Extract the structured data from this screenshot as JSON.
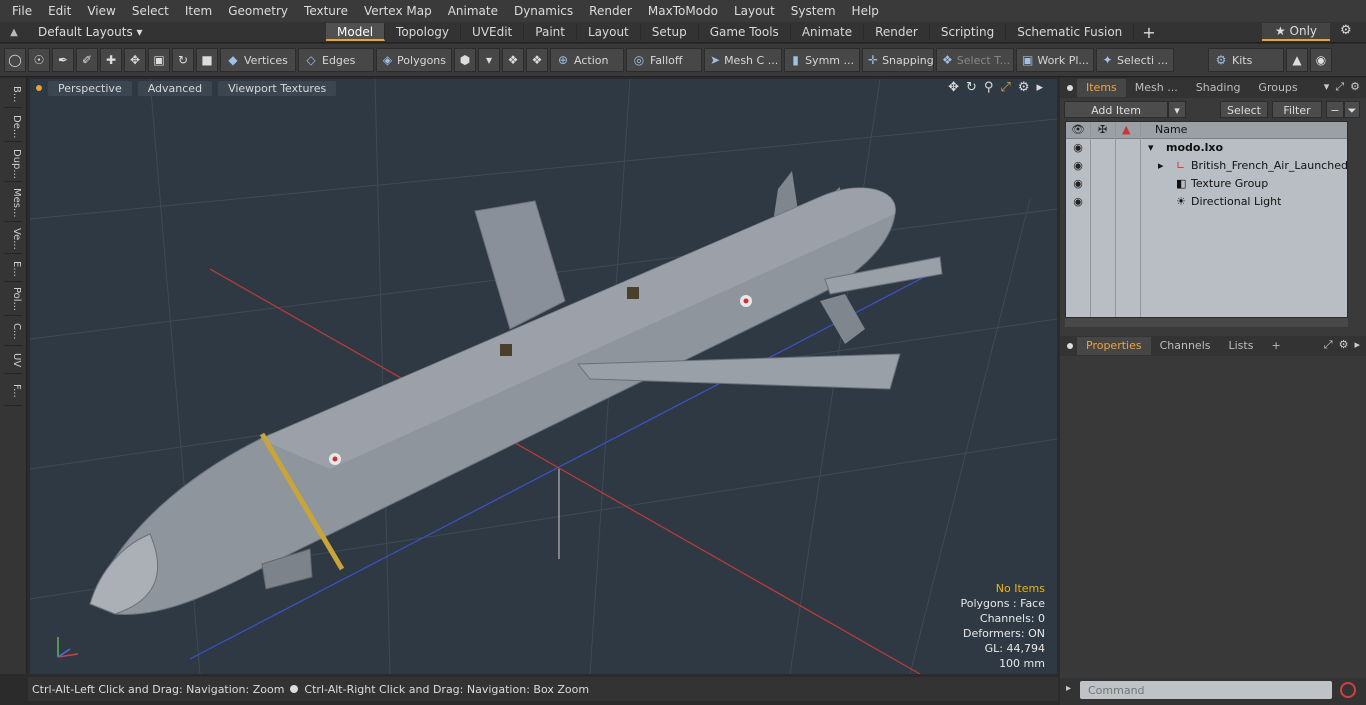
{
  "menu": [
    "File",
    "Edit",
    "View",
    "Select",
    "Item",
    "Geometry",
    "Texture",
    "Vertex Map",
    "Animate",
    "Dynamics",
    "Render",
    "MaxToModo",
    "Layout",
    "System",
    "Help"
  ],
  "layout": {
    "current": "Default Layouts ▾",
    "tabs": [
      "Model",
      "Topology",
      "UVEdit",
      "Paint",
      "Layout",
      "Setup",
      "Game Tools",
      "Animate",
      "Render",
      "Scripting",
      "Schematic Fusion"
    ],
    "active_tab": "Model",
    "only_label": "★ Only"
  },
  "toolbar": {
    "vertices": "Vertices",
    "edges": "Edges",
    "polygons": "Polygons",
    "action": "Action",
    "falloff": "Falloff",
    "mesh": "Mesh C ...",
    "symmetry": "Symm ...",
    "snapping": "Snapping",
    "select_t": "Select T...",
    "workplane": "Work Pl...",
    "selection": "Selecti ...",
    "kits": "Kits"
  },
  "leftstrip": [
    "B...",
    "De...",
    "Dup...",
    "Mes...",
    "Ve...",
    "E...",
    "Pol...",
    "C...",
    "UV",
    "F..."
  ],
  "viewport": {
    "perspective": "Perspective",
    "advanced": "Advanced",
    "textures": "Viewport Textures",
    "info": {
      "no_items": "No Items",
      "polygons": "Polygons : Face",
      "channels": "Channels: 0",
      "deformers": "Deformers: ON",
      "gl": "GL: 44,794",
      "scale": "100 mm"
    }
  },
  "status": {
    "left": "Ctrl-Alt-Left Click and Drag: Navigation: Zoom",
    "right": "Ctrl-Alt-Right Click and Drag: Navigation: Box Zoom"
  },
  "items_panel": {
    "tabs": [
      "Items",
      "Mesh ...",
      "Shading",
      "Groups"
    ],
    "add_item": "Add Item",
    "select": "Select",
    "filter": "Filter",
    "column_name": "Name",
    "rows": [
      {
        "label": "modo.lxo"
      },
      {
        "label": "British_French_Air_Launched ..."
      },
      {
        "label": "Texture Group"
      },
      {
        "label": "Directional Light"
      }
    ]
  },
  "properties_panel": {
    "tabs": [
      "Properties",
      "Channels",
      "Lists"
    ]
  },
  "command": {
    "placeholder": "Command"
  },
  "colors": {
    "accent": "#e7a33a",
    "viewport_bg": "#2e3944",
    "missile": "#8e959d"
  }
}
